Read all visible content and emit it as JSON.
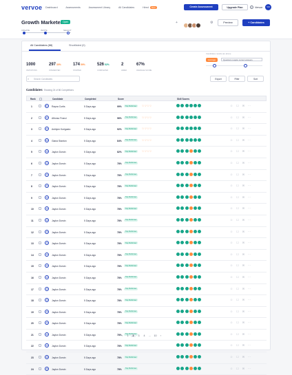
{
  "nav": {
    "logo": "vervoe",
    "links": [
      "Dashboard",
      "Assessments",
      "Assessment Library",
      "All Candidates",
      "Hired"
    ],
    "new_badge": "New",
    "create_label": "Create Assessment",
    "upgrade_label": "Upgrade Plan",
    "help": "?",
    "account_name": "Vervoe",
    "account_initials": "VM"
  },
  "header": {
    "title": "Growth Marketer",
    "status": "Open",
    "steps": [
      "CREATE",
      "INVITE",
      "SELECT"
    ],
    "preview_label": "Preview",
    "add_candidates_label": "+ Candidates"
  },
  "tabs": {
    "all": "All Candidates (88)",
    "shortlisted": "Shortlisted (0)"
  },
  "stats": [
    {
      "num": "1000",
      "pct": "",
      "label": "INVITATIONS"
    },
    {
      "num": "297",
      "pct": "30%",
      "label": "INTERESTED"
    },
    {
      "num": "174",
      "pct": "59%",
      "label": "STARTED"
    },
    {
      "num": "526",
      "pct": "52%",
      "label": "COMPLETED"
    },
    {
      "num": "2",
      "pct": "",
      "label": "HIRED"
    },
    {
      "num": "67%",
      "pct": "",
      "label": "AVERAGE SCORE"
    }
  ],
  "filters": {
    "caption": "Candidates results are above",
    "average": "Average",
    "questions_placeholder": "Questions require correct answers"
  },
  "toolbar": {
    "search_placeholder": "Search Candidates",
    "export": "Export",
    "filter": "Filter",
    "sort": "Sort"
  },
  "candidates_heading": "Candidates",
  "candidates_sub": "Showing 24 of 86 Completions",
  "table": {
    "headers": {
      "rank": "Rank",
      "candidate": "Candidate",
      "completed": "Completed",
      "score": "Score",
      "skills": "Skill Scores"
    },
    "rows": [
      {
        "rank": "1",
        "initials": "RC",
        "name": "Rayna Curtis",
        "completed": "5 Days ago",
        "score": "99%",
        "tag": "Top Performer",
        "hearts": "♡♡♡♡",
        "dots": [
          "#17a589",
          "#17a589",
          "#17a589",
          "#17a589",
          "#17a589",
          "#17a589"
        ]
      },
      {
        "rank": "2",
        "initials": "AF",
        "name": "Alfonso Franci",
        "completed": "5 Days ago",
        "score": "96%",
        "tag": "Top Performer",
        "hearts": "♡♡♡♡",
        "dots": [
          "#17a589",
          "#17a589",
          "#17a589",
          "#17a589",
          "#17a589",
          "#17a589"
        ]
      },
      {
        "rank": "3",
        "initials": "AK",
        "name": "Ashlynn Korigasto",
        "completed": "5 Days ago",
        "score": "92%",
        "tag": "Top Performer",
        "hearts": "♡♡♡♡",
        "dots": [
          "#17a589",
          "#17a589",
          "#17a589",
          "#17a589",
          "#17a589",
          "#17a589"
        ]
      },
      {
        "rank": "4",
        "initials": "GS",
        "name": "Giana Stanton",
        "completed": "5 Days ago",
        "score": "84%",
        "tag": "Top Performer",
        "hearts": "♡♡♡♡",
        "dots": [
          "#17a589",
          "#17a589",
          "#17a589",
          "#17a589",
          "#17a589",
          "#17a589"
        ]
      },
      {
        "rank": "5",
        "initials": "JD",
        "name": "Jaylon Dorsin",
        "completed": "5 Days ago",
        "score": "82%",
        "tag": "Top Performer",
        "hearts": "♡♡♡♡",
        "dots": [
          "#17a589",
          "#17a589",
          "#17a589",
          "#ff8a3d",
          "#17a589",
          "#17a589"
        ]
      },
      {
        "rank": "6",
        "initials": "JD",
        "name": "Jaylon Dorsin",
        "completed": "5 Days ago",
        "score": "78%",
        "tag": "Top Performer",
        "hearts": "",
        "dots": [
          "#17a589",
          "#17a589",
          "#17a589",
          "#ff8a3d",
          "#17a589",
          "#17a589"
        ]
      },
      {
        "rank": "7",
        "initials": "JD",
        "name": "Jaylon Dorsin",
        "completed": "5 Days ago",
        "score": "78%",
        "tag": "Top Performer",
        "hearts": "",
        "dots": [
          "#17a589",
          "#17a589",
          "#17a589",
          "#ff8a3d",
          "#17a589",
          "#17a589"
        ]
      },
      {
        "rank": "8",
        "initials": "JD",
        "name": "Jaylon Dorsin",
        "completed": "5 Days ago",
        "score": "78%",
        "tag": "Top Performer",
        "hearts": "",
        "dots": [
          "#17a589",
          "#17a589",
          "#17a589",
          "#ff8a3d",
          "#17a589",
          "#17a589"
        ]
      },
      {
        "rank": "9",
        "initials": "JD",
        "name": "Jaylon Dorsin",
        "completed": "5 Days ago",
        "score": "78%",
        "tag": "Top Performer",
        "hearts": "",
        "dots": [
          "#17a589",
          "#17a589",
          "#17a589",
          "#ff8a3d",
          "#17a589",
          "#17a589"
        ]
      },
      {
        "rank": "10",
        "initials": "JD",
        "name": "Jaylon Dorsin",
        "completed": "5 Days ago",
        "score": "78%",
        "tag": "Top Performer",
        "hearts": "",
        "dots": [
          "#17a589",
          "#17a589",
          "#17a589",
          "#ff8a3d",
          "#17a589",
          "#17a589"
        ]
      },
      {
        "rank": "11",
        "initials": "JD",
        "name": "Jaylon Dorsin",
        "completed": "5 Days ago",
        "score": "78%",
        "tag": "Top Performer",
        "hearts": "",
        "dots": [
          "#17a589",
          "#17a589",
          "#17a589",
          "#ff8a3d",
          "#17a589",
          "#17a589"
        ]
      },
      {
        "rank": "12",
        "initials": "JD",
        "name": "Jaylon Dorsin",
        "completed": "5 Days ago",
        "score": "78%",
        "tag": "Top Performer",
        "hearts": "",
        "dots": [
          "#17a589",
          "#17a589",
          "#17a589",
          "#ff8a3d",
          "#17a589",
          "#17a589"
        ]
      },
      {
        "rank": "13",
        "initials": "JD",
        "name": "Jaylon Dorsin",
        "completed": "5 Days ago",
        "score": "78%",
        "tag": "Top Performer",
        "hearts": "",
        "dots": [
          "#17a589",
          "#17a589",
          "#17a589",
          "#ff8a3d",
          "#17a589",
          "#17a589"
        ]
      },
      {
        "rank": "14",
        "initials": "JD",
        "name": "Jaylon Dorsin",
        "completed": "5 Days ago",
        "score": "78%",
        "tag": "Top Performer",
        "hearts": "",
        "dots": [
          "#17a589",
          "#17a589",
          "#17a589",
          "#ff8a3d",
          "#17a589",
          "#17a589"
        ]
      },
      {
        "rank": "15",
        "initials": "JD",
        "name": "Jaylon Dorsin",
        "completed": "5 Days ago",
        "score": "78%",
        "tag": "Top Performer",
        "hearts": "",
        "dots": [
          "#17a589",
          "#17a589",
          "#17a589",
          "#ff8a3d",
          "#17a589",
          "#17a589"
        ]
      },
      {
        "rank": "16",
        "initials": "JD",
        "name": "Jaylon Dorsin",
        "completed": "5 Days ago",
        "score": "78%",
        "tag": "Top Performer",
        "hearts": "",
        "dots": [
          "#17a589",
          "#17a589",
          "#17a589",
          "#ff8a3d",
          "#17a589",
          "#17a589"
        ]
      },
      {
        "rank": "17",
        "initials": "JD",
        "name": "Jaylon Dorsin",
        "completed": "5 Days ago",
        "score": "78%",
        "tag": "Top Performer",
        "hearts": "",
        "dots": [
          "#17a589",
          "#17a589",
          "#17a589",
          "#ff8a3d",
          "#17a589",
          "#17a589"
        ]
      },
      {
        "rank": "18",
        "initials": "JD",
        "name": "Jaylon Dorsin",
        "completed": "5 Days ago",
        "score": "78%",
        "tag": "Top Performer",
        "hearts": "",
        "dots": [
          "#17a589",
          "#17a589",
          "#17a589",
          "#ff8a3d",
          "#17a589",
          "#17a589"
        ]
      },
      {
        "rank": "19",
        "initials": "JD",
        "name": "Jaylon Dorsin",
        "completed": "5 Days ago",
        "score": "78%",
        "tag": "Top Performer",
        "hearts": "",
        "dots": [
          "#17a589",
          "#17a589",
          "#17a589",
          "#ff8a3d",
          "#17a589",
          "#17a589"
        ]
      },
      {
        "rank": "20",
        "initials": "JD",
        "name": "Jaylon Dorsin",
        "completed": "5 Days ago",
        "score": "78%",
        "tag": "Top Performer",
        "hearts": "",
        "dots": [
          "#17a589",
          "#17a589",
          "#17a589",
          "#ff8a3d",
          "#17a589",
          "#17a589"
        ]
      },
      {
        "rank": "21",
        "initials": "JD",
        "name": "Jaylon Dorsin",
        "completed": "5 Days ago",
        "score": "78%",
        "tag": "Top Performer",
        "hearts": "",
        "dots": [
          "#17a589",
          "#17a589",
          "#17a589",
          "#ff8a3d",
          "#17a589",
          "#17a589"
        ]
      },
      {
        "rank": "22",
        "initials": "JD",
        "name": "Jaylon Dorsin",
        "completed": "5 Days ago",
        "score": "78%",
        "tag": "Top Performer",
        "hearts": "",
        "dots": [
          "#17a589",
          "#17a589",
          "#17a589",
          "#ff8a3d",
          "#17a589",
          "#17a589"
        ]
      },
      {
        "rank": "23",
        "initials": "JD",
        "name": "Jaylon Dorsin",
        "completed": "5 Days ago",
        "score": "78%",
        "tag": "Top Performer",
        "hearts": "",
        "dots": [
          "#17a589",
          "#17a589",
          "#17a589",
          "#ff8a3d",
          "#17a589",
          "#17a589"
        ]
      },
      {
        "rank": "24",
        "initials": "JD",
        "name": "Jaylon Dorsin",
        "completed": "5 Days ago",
        "score": "78%",
        "tag": "Top Performer",
        "hearts": "",
        "dots": [
          "#17a589",
          "#17a589",
          "#17a589",
          "#ff8a3d",
          "#17a589",
          "#17a589"
        ]
      }
    ]
  },
  "pagination": {
    "prev": "‹",
    "pages": [
      "1",
      "2",
      "3",
      "4",
      "...",
      "10"
    ],
    "current": "2",
    "next": "›"
  },
  "colors": {
    "accent": "#1f3fbf",
    "success": "#17a589",
    "warning": "#ff8a3d"
  }
}
